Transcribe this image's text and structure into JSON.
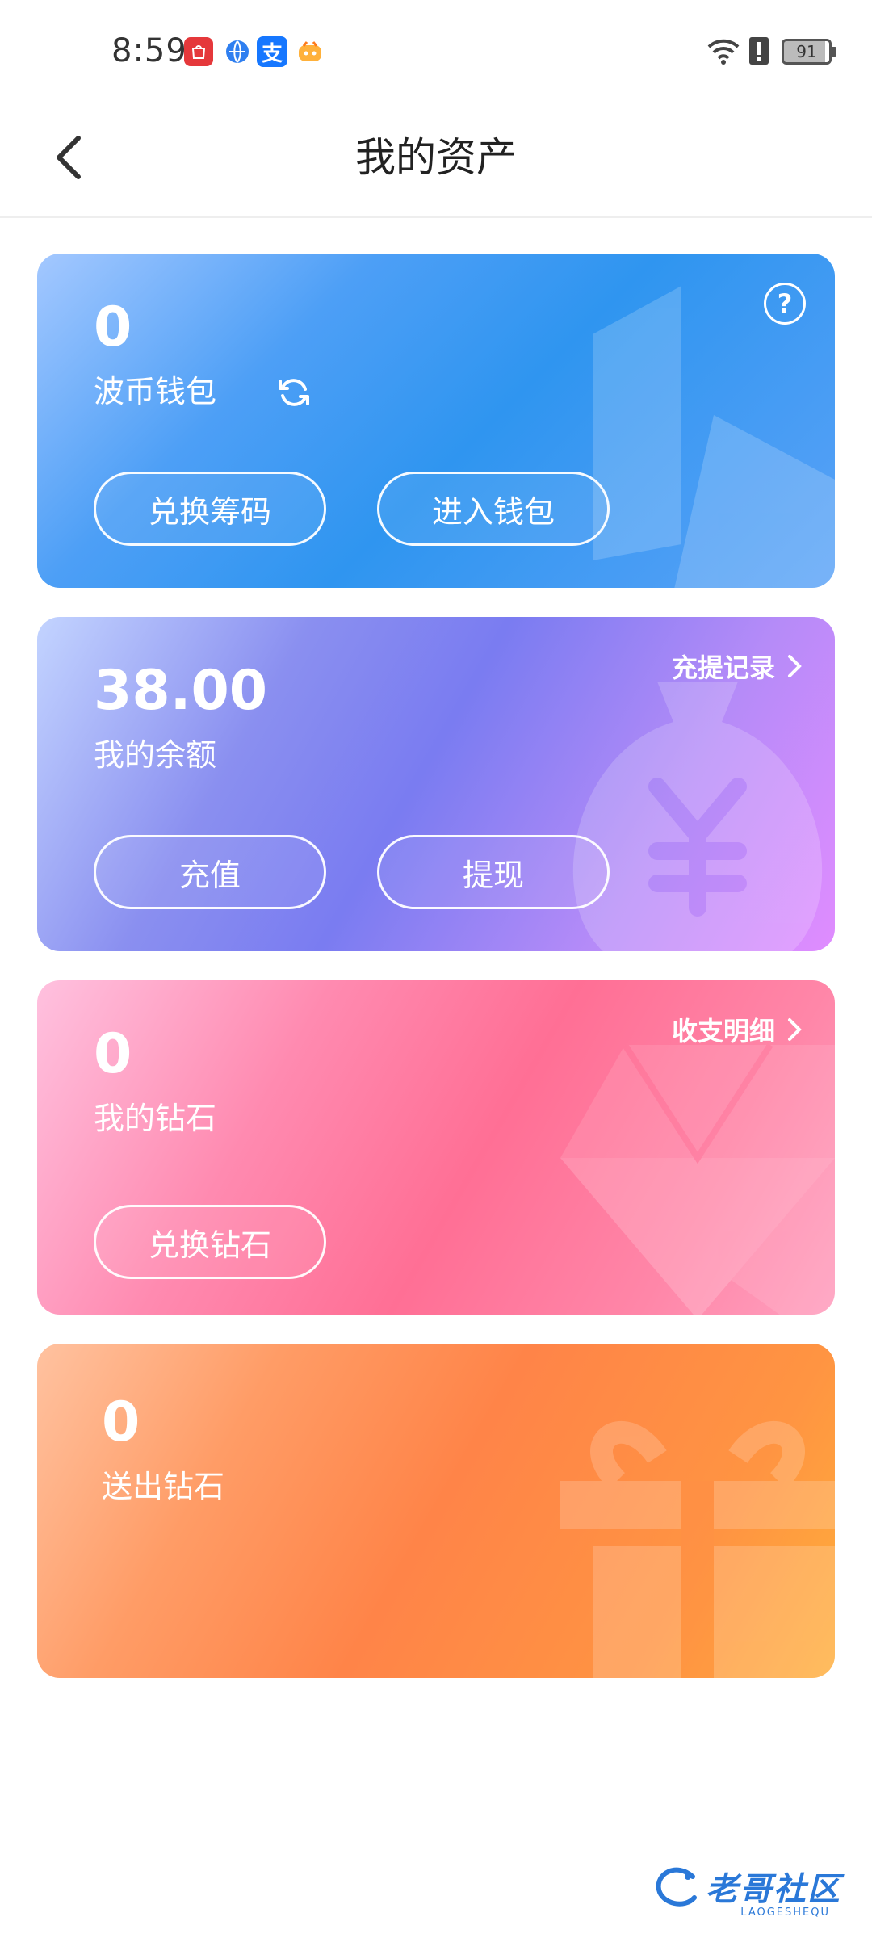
{
  "status_bar": {
    "time": "8:59",
    "battery": "91",
    "left_icons": [
      "huawei-appgallery-icon",
      "browser-icon",
      "alipay-icon",
      "taobao-icon"
    ],
    "right_icons": [
      "wifi-icon",
      "alert-icon",
      "battery-icon"
    ]
  },
  "header": {
    "title": "我的资产"
  },
  "cards": {
    "wallet": {
      "amount": "0",
      "label": "波币钱包",
      "buttons": [
        "兑换筹码",
        "进入钱包"
      ],
      "color": "#3C9BF4"
    },
    "balance": {
      "amount": "38.00",
      "label": "我的余额",
      "link": "充提记录",
      "buttons": [
        "充值",
        "提现"
      ],
      "color": "#8A86F2"
    },
    "diamonds": {
      "amount": "0",
      "label": "我的钻石",
      "link": "收支明细",
      "buttons": [
        "兑换钻石"
      ],
      "color": "#FF7A9C"
    },
    "sent": {
      "amount": "0",
      "label": "送出钻石",
      "color": "#FF8C4A"
    }
  },
  "watermark": {
    "text": "老哥社区",
    "sub": "LAOGESHEQU"
  }
}
